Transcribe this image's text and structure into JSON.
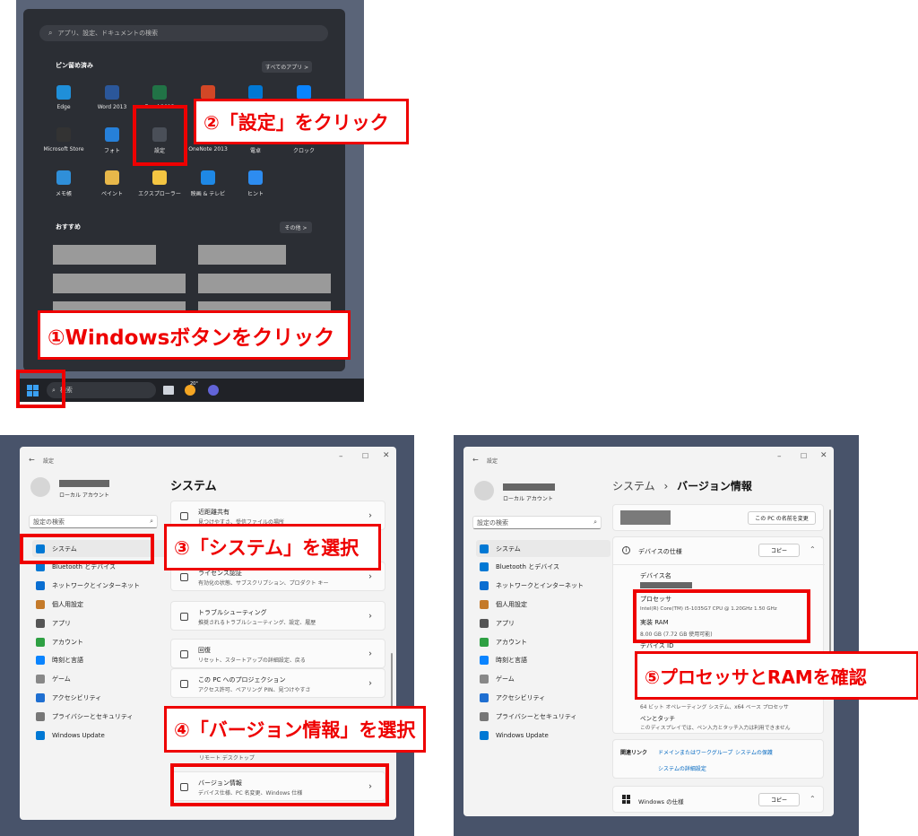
{
  "start": {
    "search_placeholder": "アプリ、設定、ドキュメントの検索",
    "pinned_title": "ピン留め済み",
    "all_apps": "すべてのアプリ  >",
    "apps": [
      "Edge",
      "Word 2013",
      "Excel 2013",
      "Pow",
      "",
      "",
      "Microsoft Store",
      "フォト",
      "設定",
      "OneNote 2013",
      "電卓",
      "クロック",
      "メモ帳",
      "ペイント",
      "エクスプローラー",
      "映画 & テレビ",
      "ヒント"
    ],
    "recommended_title": "おすすめ",
    "more": "その他  >",
    "taskbar_search": "検索",
    "weather": "20°"
  },
  "callouts": {
    "c1": "①Windowsボタンをクリック",
    "c2": "②「設定」をクリック",
    "c3": "③「システム」を選択",
    "c4": "④「バージョン情報」を選択",
    "c5": "⑤プロセッサとRAMを確認"
  },
  "settings": {
    "window_title": "設定",
    "account_type": "ローカル アカウント",
    "search_placeholder": "設定の検索",
    "nav": [
      "システム",
      "Bluetooth とデバイス",
      "ネットワークとインターネット",
      "個人用設定",
      "アプリ",
      "アカウント",
      "時刻と言語",
      "ゲーム",
      "アクセシビリティ",
      "プライバシーとセキュリティ",
      "Windows Update"
    ],
    "page_title": "システム",
    "items": [
      {
        "title": "近距離共有",
        "desc": "見つけやすさ、受信ファイルの場所"
      },
      {
        "title": "ライセンス認証",
        "desc": "有効化の状態、サブスクリプション、プロダクト キー"
      },
      {
        "title": "トラブルシューティング",
        "desc": "推奨されるトラブルシューティング、設定、履歴"
      },
      {
        "title": "回復",
        "desc": "リセット、スタートアップの詳細設定、戻る"
      },
      {
        "title": "この PC へのプロジェクション",
        "desc": "アクセス許可、ペアリング PIN、見つけやすさ"
      },
      {
        "title": "バージョン情報",
        "desc": "デバイス仕様、PC 名変更、Windows 仕様"
      }
    ],
    "partial_line": "リモート デスクトップ"
  },
  "about": {
    "window_title": "設定",
    "breadcrumb_parent": "システム",
    "breadcrumb_sep": "›",
    "breadcrumb_current": "バージョン情報",
    "rename_button": "この PC の名前を変更",
    "device_spec_title": "デバイスの仕様",
    "copy": "コピー",
    "device_name_label": "デバイス名",
    "processor_label": "プロセッサ",
    "processor_value": "Intel(R) Core(TM) i5-1035G7 CPU @ 1.20GHz   1.50 GHz",
    "ram_label": "実装 RAM",
    "ram_value": "8.00 GB (7.72 GB 使用可能)",
    "device_id_partial": "デバイス ID",
    "system_type": "64 ビット オペレーティング システム、x64 ベース プロセッサ",
    "pen_label": "ペンとタッチ",
    "pen_value": "このディスプレイでは、ペン入力とタッチ入力は利用できません",
    "related_label": "関連リンク",
    "related_links": [
      "ドメインまたはワークグループ",
      "システムの保護"
    ],
    "advanced": "システムの詳細設定",
    "win_spec_title": "Windows の仕様"
  },
  "colors": {
    "accent": "#0067c0",
    "callout": "#e00000"
  }
}
